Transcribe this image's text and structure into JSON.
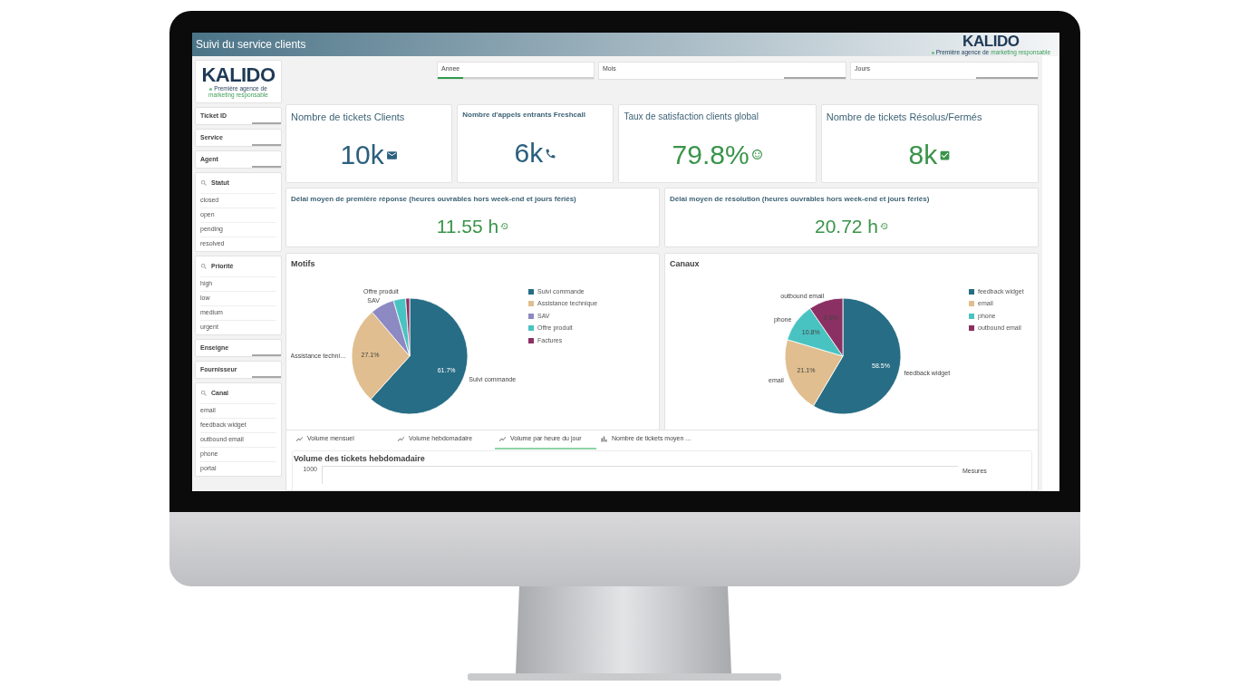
{
  "window": {
    "title": "Suivi du service clients"
  },
  "header_logo": {
    "name": "KALIDO",
    "tagline": "Première agence de",
    "tagline_accent": "marketing responsable"
  },
  "sidebar": {
    "logo": {
      "name": "KALIDO",
      "tagline": "Première agence de",
      "tagline_accent": "marketing responsable"
    },
    "filters": [
      {
        "kind": "field",
        "label": "Ticket ID"
      },
      {
        "kind": "field",
        "label": "Service"
      },
      {
        "kind": "field",
        "label": "Agent"
      },
      {
        "kind": "list",
        "label": "Statut",
        "items": [
          "closed",
          "open",
          "pending",
          "resolved"
        ]
      },
      {
        "kind": "list",
        "label": "Priorité",
        "items": [
          "high",
          "low",
          "medium",
          "urgent"
        ]
      },
      {
        "kind": "field",
        "label": "Enseigne"
      },
      {
        "kind": "field",
        "label": "Fournisseur"
      },
      {
        "kind": "list",
        "label": "Canal",
        "items": [
          "email",
          "feedback widget",
          "outbound email",
          "phone",
          "portal"
        ]
      }
    ]
  },
  "date_filters": [
    {
      "label": "Annee",
      "selected": true
    },
    {
      "label": "Mois",
      "selected": false
    },
    {
      "label": "Jours",
      "selected": false
    }
  ],
  "kpis": [
    {
      "title": "Nombre de tickets Clients",
      "value": "10k",
      "color": "#2b5f7e"
    },
    {
      "title": "Nombre d'appels entrants Freshcall",
      "value": "6k",
      "color": "#2b5f7e"
    },
    {
      "title": "Taux de satisfaction clients global",
      "value": "79.8%",
      "color": "#3a944a"
    },
    {
      "title": "Nombre de tickets Résolus/Fermés",
      "value": "8k",
      "color": "#3a944a"
    }
  ],
  "delays": [
    {
      "title": "Délai moyen de première réponse (heures ouvrables hors week-end et jours fériés)",
      "value": "11.55 h"
    },
    {
      "title": "Délai moyen de résolution (heures ouvrables hors week-end et jours fériés)",
      "value": "20.72 h"
    }
  ],
  "pies": [
    {
      "chart_data": {
        "type": "pie",
        "title": "Motifs",
        "categories": [
          "Suivi commande",
          "Assistance technique",
          "SAV",
          "Offre produit",
          "Factures"
        ],
        "values": [
          61.7,
          27.1,
          6.7,
          3.4,
          1.1
        ],
        "colors": [
          "#276d85",
          "#e0be8f",
          "#8d89c2",
          "#49c3c1",
          "#8b3063"
        ],
        "value_labels": [
          "61.7%",
          "27.1%",
          null,
          null,
          null
        ],
        "annotations": [
          "Suivi commande",
          "Assistance techni…",
          "SAV",
          "Offre produit",
          null
        ]
      }
    },
    {
      "chart_data": {
        "type": "pie",
        "title": "Canaux",
        "categories": [
          "feedback widget",
          "email",
          "phone",
          "outbound email"
        ],
        "values": [
          58.5,
          21.1,
          10.8,
          9.6
        ],
        "colors": [
          "#276d85",
          "#e0be8f",
          "#49c3c1",
          "#8b3063"
        ],
        "value_labels": [
          "58.5%",
          "21.1%",
          "10.8%",
          "9.6%"
        ],
        "annotations": [
          "feedback widget",
          "email",
          "phone",
          "outbound email"
        ]
      }
    }
  ],
  "trend_panel": {
    "tabs": [
      {
        "label": "Volume mensuel",
        "kind": "line",
        "selected": false
      },
      {
        "label": "Volume hebdomadaire",
        "kind": "line",
        "selected": false
      },
      {
        "label": "Volume par heure du jour",
        "kind": "line",
        "selected": true
      },
      {
        "label": "Nombre de tickets moyen ...",
        "kind": "bar",
        "selected": false
      }
    ],
    "chart_title": "Volume des tickets hebdomadaire",
    "y_tick": "1000",
    "legend_title": "Mesures"
  }
}
